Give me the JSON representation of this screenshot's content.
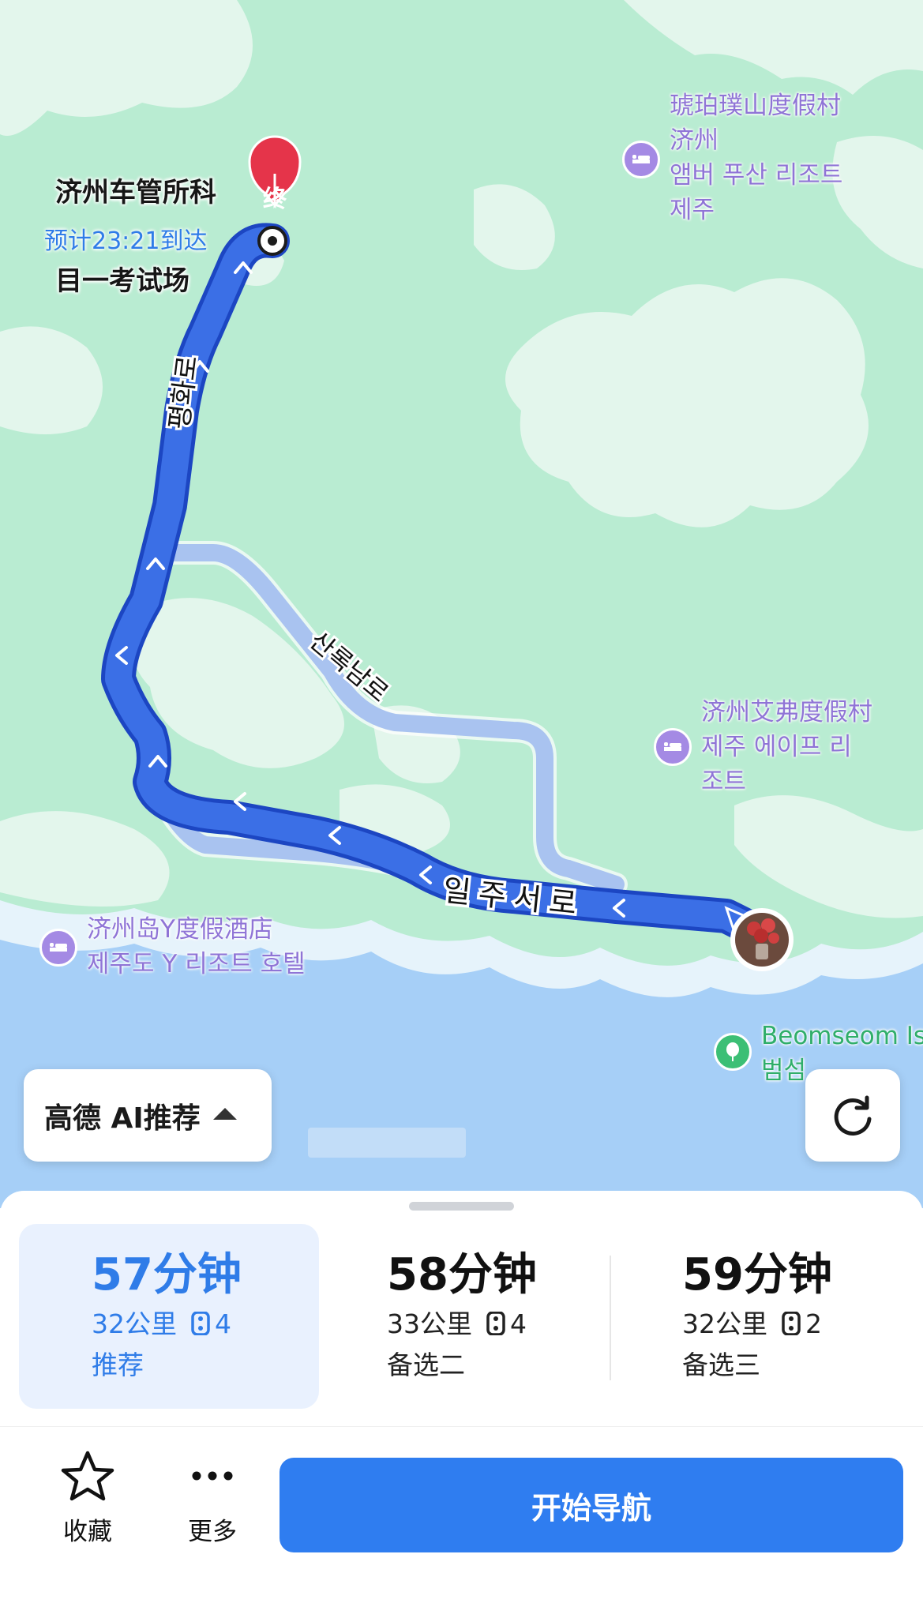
{
  "map": {
    "destination": {
      "marker_label": "终",
      "name_line1": "济州车管所科",
      "name_line2": "目一考试场",
      "eta": "预计23:21到达"
    },
    "pois": [
      {
        "name": "琥珀璞山度假村\n济州\n앰버 푸산 리조트\n제주",
        "icon": "hotel-icon"
      },
      {
        "name": "济州艾弗度假村\n제주 에이프 리\n조트",
        "icon": "hotel-icon"
      },
      {
        "name": "济州岛Y度假酒店\n제주도 Y 리조트 호텔",
        "icon": "hotel-icon"
      },
      {
        "name": "Beomseom Is\n범섬",
        "icon": "park-icon"
      }
    ],
    "road_labels": [
      "평화로",
      "산록남로",
      "일주서로"
    ],
    "colors": {
      "land": "#b9ecd2",
      "land_light": "#e3f6ec",
      "sea": "#a6cff7",
      "route_primary": "#3b6fe6",
      "route_alt": "#a9c3f0",
      "dest_marker": "#e5344a"
    }
  },
  "overlay": {
    "ai_recommend_label": "高德 AI推荐",
    "refresh_icon": "refresh-icon"
  },
  "routes": [
    {
      "time": "57分钟",
      "distance": "32公里",
      "traffic_lights": "4",
      "tag": "推荐",
      "selected": true
    },
    {
      "time": "58分钟",
      "distance": "33公里",
      "traffic_lights": "4",
      "tag": "备选二",
      "selected": false
    },
    {
      "time": "59分钟",
      "distance": "32公里",
      "traffic_lights": "2",
      "tag": "备选三",
      "selected": false
    }
  ],
  "actions": {
    "favorite_label": "收藏",
    "more_label": "更多",
    "start_nav_label": "开始导航"
  }
}
